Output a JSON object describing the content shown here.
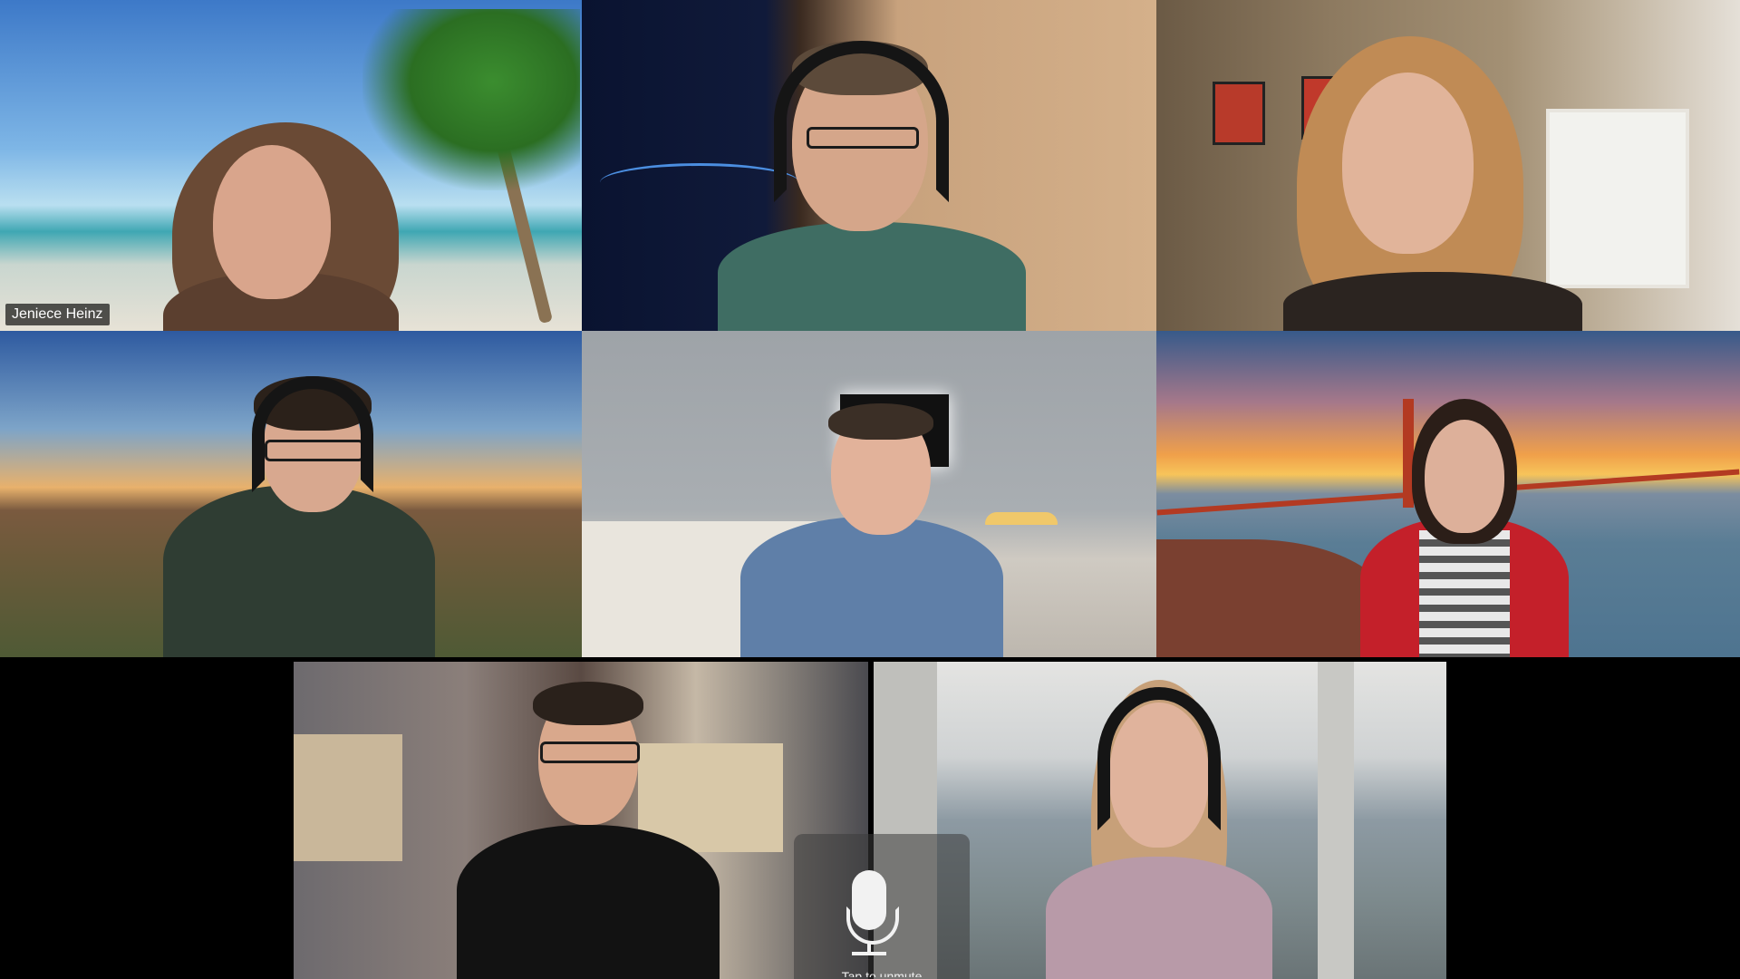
{
  "meeting": {
    "active_speaker": "Jeniece Heinz",
    "highlight_color": "#c7e04a"
  },
  "participants": [
    {
      "id": "p1",
      "name": "Jeniece Heinz",
      "name_visible": true,
      "background": "beach-palm",
      "active": true
    },
    {
      "id": "p2",
      "name": "",
      "name_visible": false,
      "background": "space-window"
    },
    {
      "id": "p3",
      "name": "",
      "name_visible": false,
      "background": "living-room-posters"
    },
    {
      "id": "p4",
      "name": "",
      "name_visible": false,
      "background": "desert-sunset"
    },
    {
      "id": "p5",
      "name": "",
      "name_visible": false,
      "background": "home-office"
    },
    {
      "id": "p6",
      "name": "",
      "name_visible": false,
      "background": "golden-gate-sunset"
    },
    {
      "id": "p7",
      "name": "",
      "name_visible": false,
      "background": "cluttered-office"
    },
    {
      "id": "p8",
      "name": "",
      "name_visible": false,
      "background": "window-city-view"
    }
  ],
  "controls": {
    "mic_icon": "microphone-icon",
    "mic_label": "Tap to unmute"
  }
}
